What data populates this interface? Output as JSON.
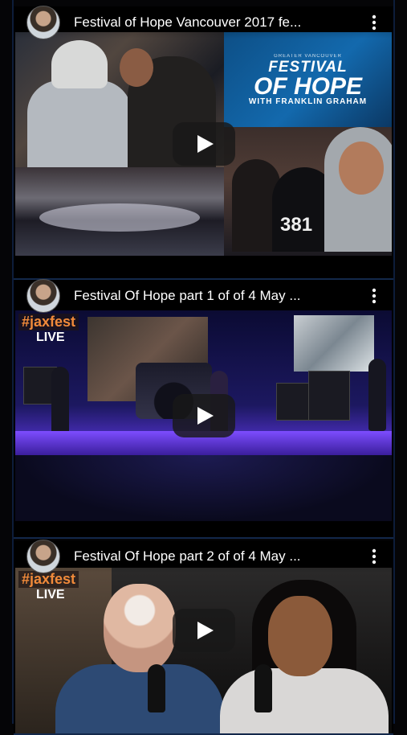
{
  "videos": [
    {
      "title": "Festival of Hope Vancouver 2017 fe...",
      "thumbnail": {
        "banner_line1": "GREATER VANCOUVER",
        "banner_line2": "FESTIVAL",
        "banner_line3": "OF HOPE",
        "banner_line4": "WITH FRANKLIN GRAHAM",
        "jersey_number": "381"
      }
    },
    {
      "title": "Festival Of Hope part 1 of of 4 May ...",
      "thumbnail": {
        "hashtag": "#jaxfest",
        "live": "LIVE"
      }
    },
    {
      "title": "Festival Of Hope part 2 of of 4 May ...",
      "thumbnail": {
        "hashtag": "#jaxfest",
        "live": "LIVE"
      }
    }
  ],
  "icons": {
    "more": "more-vert-icon",
    "play": "play-icon",
    "avatar": "channel-avatar"
  },
  "colors": {
    "background": "#050507",
    "divider": "#13284a",
    "play_button_bg": "#191919",
    "hashtag": "#f08a3a"
  }
}
